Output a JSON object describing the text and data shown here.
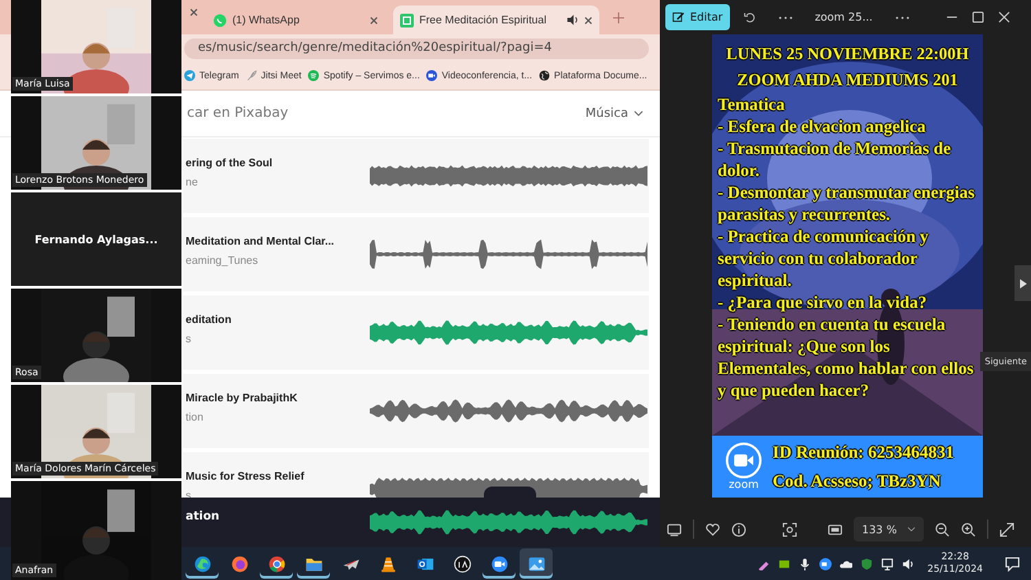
{
  "browser": {
    "tabs": [
      {
        "title": "(1) WhatsApp",
        "kind": "chat",
        "selected": false,
        "audio": false
      },
      {
        "title": "Free Meditación Espiritual",
        "kind": "pixabay",
        "selected": true,
        "audio": true
      }
    ],
    "address": "es/music/search/genre/meditación%20espiritual/?pagi=4",
    "bookmarks": [
      {
        "label": "Telegram",
        "kind": "plane"
      },
      {
        "label": "Jitsi Meet",
        "kind": "feather"
      },
      {
        "label": "Spotify – Servimos e...",
        "kind": "music"
      },
      {
        "label": "Videoconferencia, t...",
        "kind": "video"
      },
      {
        "label": "Plataforma Docume...",
        "kind": "globe"
      }
    ],
    "search": {
      "placeholder": "car en Pixabay",
      "filter": "Música"
    },
    "tracks": [
      {
        "title": "ering of the Soul",
        "artist": "ne",
        "color": "#6b6b6b"
      },
      {
        "title": "Meditation and Mental Clar...",
        "artist": "eaming_Tunes",
        "color": "#6b6b6b"
      },
      {
        "title": "editation",
        "artist": "s",
        "color": "#1fa86d"
      },
      {
        "title": "Miracle by PrabajithK",
        "artist": "tion",
        "color": "#6b6b6b"
      },
      {
        "title": "Music for Stress Relief",
        "artist": "s",
        "color": "#6b6b6b"
      }
    ],
    "player": {
      "title": "ation",
      "color": "#1fa86d"
    }
  },
  "meeting": {
    "participants": [
      {
        "name": "María Luisa",
        "kind": "video"
      },
      {
        "name": "Lorenzo Brotons Monedero",
        "kind": "video"
      },
      {
        "name": "Fernando  Aylagas...",
        "kind": "name"
      },
      {
        "name": "Rosa",
        "kind": "video"
      },
      {
        "name": "María Dolores Marín Cárceles",
        "kind": "video"
      },
      {
        "name": "Anafran",
        "kind": "video"
      }
    ]
  },
  "photos": {
    "edit_button": "Editar",
    "title": "zoom 25...",
    "zoom_level": "133 %",
    "tooltip": "Siguiente",
    "poster": {
      "headings": [
        "LUNES 25 NOVIEMBRE 22:00H",
        "ZOOM AHDA MEDIUMS 201"
      ],
      "topic_label": "Tematica",
      "items": [
        "- Esfera de elvacion angelica",
        "- Trasmutacion de Memorias de dolor.",
        "- Desmontar y transmutar energias parasitas y recurrentes.",
        "- Practica de comunicación y servicio con tu colaborador espiritual.",
        "- ¿Para que sirvo en la vida?",
        "- Teniendo en cuenta tu escuela espiritual: ¿Que son los Elementales, como hablar con ellos y que pueden hacer?"
      ],
      "logo_text": "zoom",
      "meeting_id": "ID Reunión: 6253464831",
      "access_code": "Cod. Acsseso; TBz3YN"
    }
  },
  "taskbar": {
    "apps": [
      {
        "kind": "edge",
        "running": true,
        "active": false
      },
      {
        "kind": "firefox",
        "running": false,
        "active": false
      },
      {
        "kind": "chrome",
        "running": true,
        "active": false
      },
      {
        "kind": "folder",
        "running": true,
        "active": false
      },
      {
        "kind": "plane",
        "running": false,
        "active": false
      },
      {
        "kind": "cone",
        "running": false,
        "active": false
      },
      {
        "kind": "mail",
        "running": false,
        "active": false
      },
      {
        "kind": "ring",
        "running": false,
        "active": false
      },
      {
        "kind": "camera",
        "running": true,
        "active": false
      },
      {
        "kind": "photos",
        "running": true,
        "active": true
      }
    ],
    "time": "22:28",
    "date": "25/11/2024"
  }
}
